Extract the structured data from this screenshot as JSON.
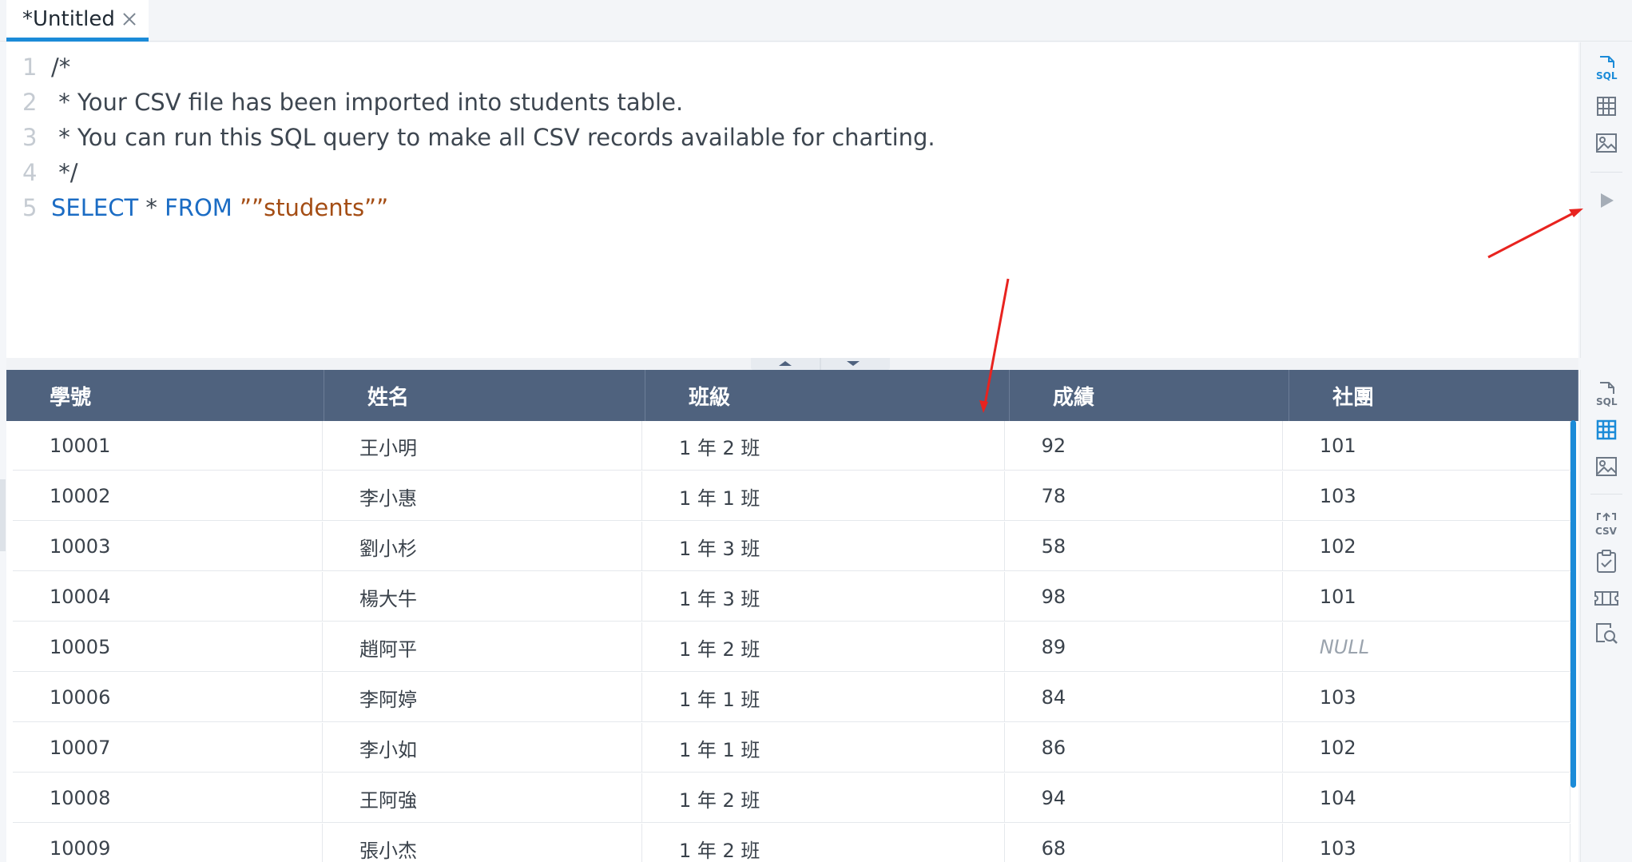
{
  "tabs": [
    {
      "label": "*Untitled"
    }
  ],
  "editor": {
    "lines": [
      {
        "num": "1",
        "segments": [
          {
            "t": "/*",
            "c": "code"
          }
        ]
      },
      {
        "num": "2",
        "segments": [
          {
            "t": " * Your CSV file has been imported into students table.",
            "c": "code"
          }
        ]
      },
      {
        "num": "3",
        "segments": [
          {
            "t": " * You can run this SQL query to make all CSV records available for charting.",
            "c": "code"
          }
        ]
      },
      {
        "num": "4",
        "segments": [
          {
            "t": " */",
            "c": "code"
          }
        ]
      },
      {
        "num": "5",
        "segments": [
          {
            "t": "SELECT",
            "c": "kw"
          },
          {
            "t": " * ",
            "c": "code"
          },
          {
            "t": "FROM",
            "c": "kw"
          },
          {
            "t": " ",
            "c": "code"
          },
          {
            "t": "””students””",
            "c": "str"
          }
        ]
      }
    ]
  },
  "editor_toolbar": {
    "sql_label": "SQL",
    "icons": [
      "sql-icon",
      "table-icon",
      "image-icon",
      "run-icon"
    ]
  },
  "grid_toolbar": {
    "sql_label": "SQL",
    "csv_label": "CSV",
    "icons": [
      "sql-icon",
      "table-icon",
      "image-icon",
      "csv-export-icon",
      "clipboard-check-icon",
      "ticket-icon",
      "search-doc-icon"
    ]
  },
  "grid": {
    "columns": [
      "學號",
      "姓名",
      "班級",
      "成績",
      "社團"
    ],
    "rows": [
      [
        "10001",
        "王小明",
        "1 年 2 班",
        "92",
        "101"
      ],
      [
        "10002",
        "李小惠",
        "1 年 1 班",
        "78",
        "103"
      ],
      [
        "10003",
        "劉小杉",
        "1 年 3 班",
        "58",
        "102"
      ],
      [
        "10004",
        "楊大牛",
        "1 年 3 班",
        "98",
        "101"
      ],
      [
        "10005",
        "趙阿平",
        "1 年 2 班",
        "89",
        "NULL"
      ],
      [
        "10006",
        "李阿婷",
        "1 年 1 班",
        "84",
        "103"
      ],
      [
        "10007",
        "李小如",
        "1 年 1 班",
        "86",
        "102"
      ],
      [
        "10008",
        "王阿強",
        "1 年 2 班",
        "94",
        "104"
      ],
      [
        "10009",
        "張小杰",
        "1 年 2 班",
        "68",
        "103"
      ]
    ]
  },
  "colors": {
    "accent": "#1b8bd8",
    "header_bg": "#4f627e",
    "keyword": "#1b6cc4",
    "string": "#a44d14",
    "annotation": "#e8231f"
  }
}
